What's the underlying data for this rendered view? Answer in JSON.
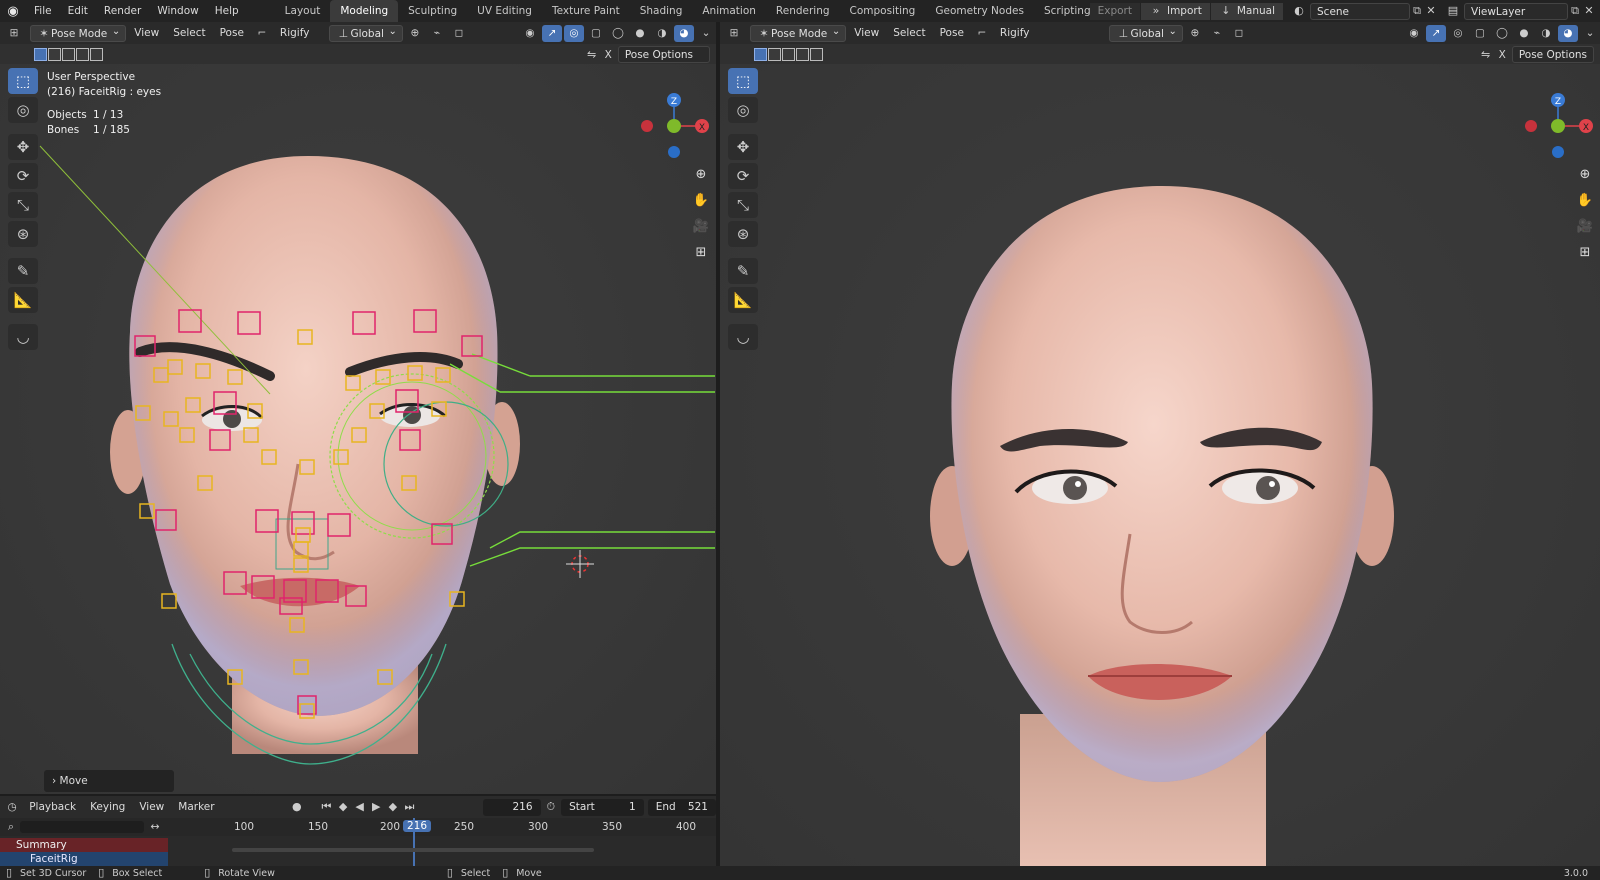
{
  "app": {
    "menus": [
      "File",
      "Edit",
      "Render",
      "Window",
      "Help"
    ],
    "workspaces": [
      "Layout",
      "Modeling",
      "Sculpting",
      "UV Editing",
      "Texture Paint",
      "Shading",
      "Animation",
      "Rendering",
      "Compositing",
      "Geometry Nodes",
      "Scripting"
    ],
    "active_workspace": "Modeling",
    "add_label": "+"
  },
  "topright": {
    "export": "Export",
    "import": "Import",
    "manual": "Manual",
    "scene": "Scene",
    "viewlayer": "ViewLayer"
  },
  "left_viewport": {
    "mode": "Pose Mode",
    "menus": [
      "View",
      "Select",
      "Pose"
    ],
    "rigify": "Rigify",
    "orientation": "Global",
    "pose_options": "Pose Options",
    "x_label": "X",
    "info": {
      "perspective": "User Perspective",
      "active": "(216) FaceitRig : eyes",
      "objects_label": "Objects",
      "objects": "1 / 13",
      "bones_label": "Bones",
      "bones": "1 / 185"
    },
    "operator_panel": "Move"
  },
  "right_viewport": {
    "mode": "Pose Mode",
    "menus": [
      "View",
      "Select",
      "Pose"
    ],
    "rigify": "Rigify",
    "orientation": "Global",
    "pose_options": "Pose Options",
    "x_label": "X"
  },
  "gizmo": {
    "z": "Z",
    "x": "X"
  },
  "timeline": {
    "menus": [
      "Playback",
      "Keying",
      "View",
      "Marker"
    ],
    "current_frame": "216",
    "start_label": "Start",
    "start": "1",
    "end_label": "End",
    "end": "521",
    "ruler": [
      "100",
      "150",
      "200",
      "216",
      "250",
      "300",
      "350",
      "400"
    ],
    "summary": "Summary",
    "object": "FaceitRig"
  },
  "status": {
    "items": [
      "Set 3D Cursor",
      "Box Select",
      "Rotate View",
      "Select",
      "Move"
    ],
    "version": "3.0.0"
  },
  "colors": {
    "accent": "#4772b3",
    "bone_select": "#e0246b",
    "bone_yellow": "#e8b520",
    "rig_green": "#7ae040"
  }
}
